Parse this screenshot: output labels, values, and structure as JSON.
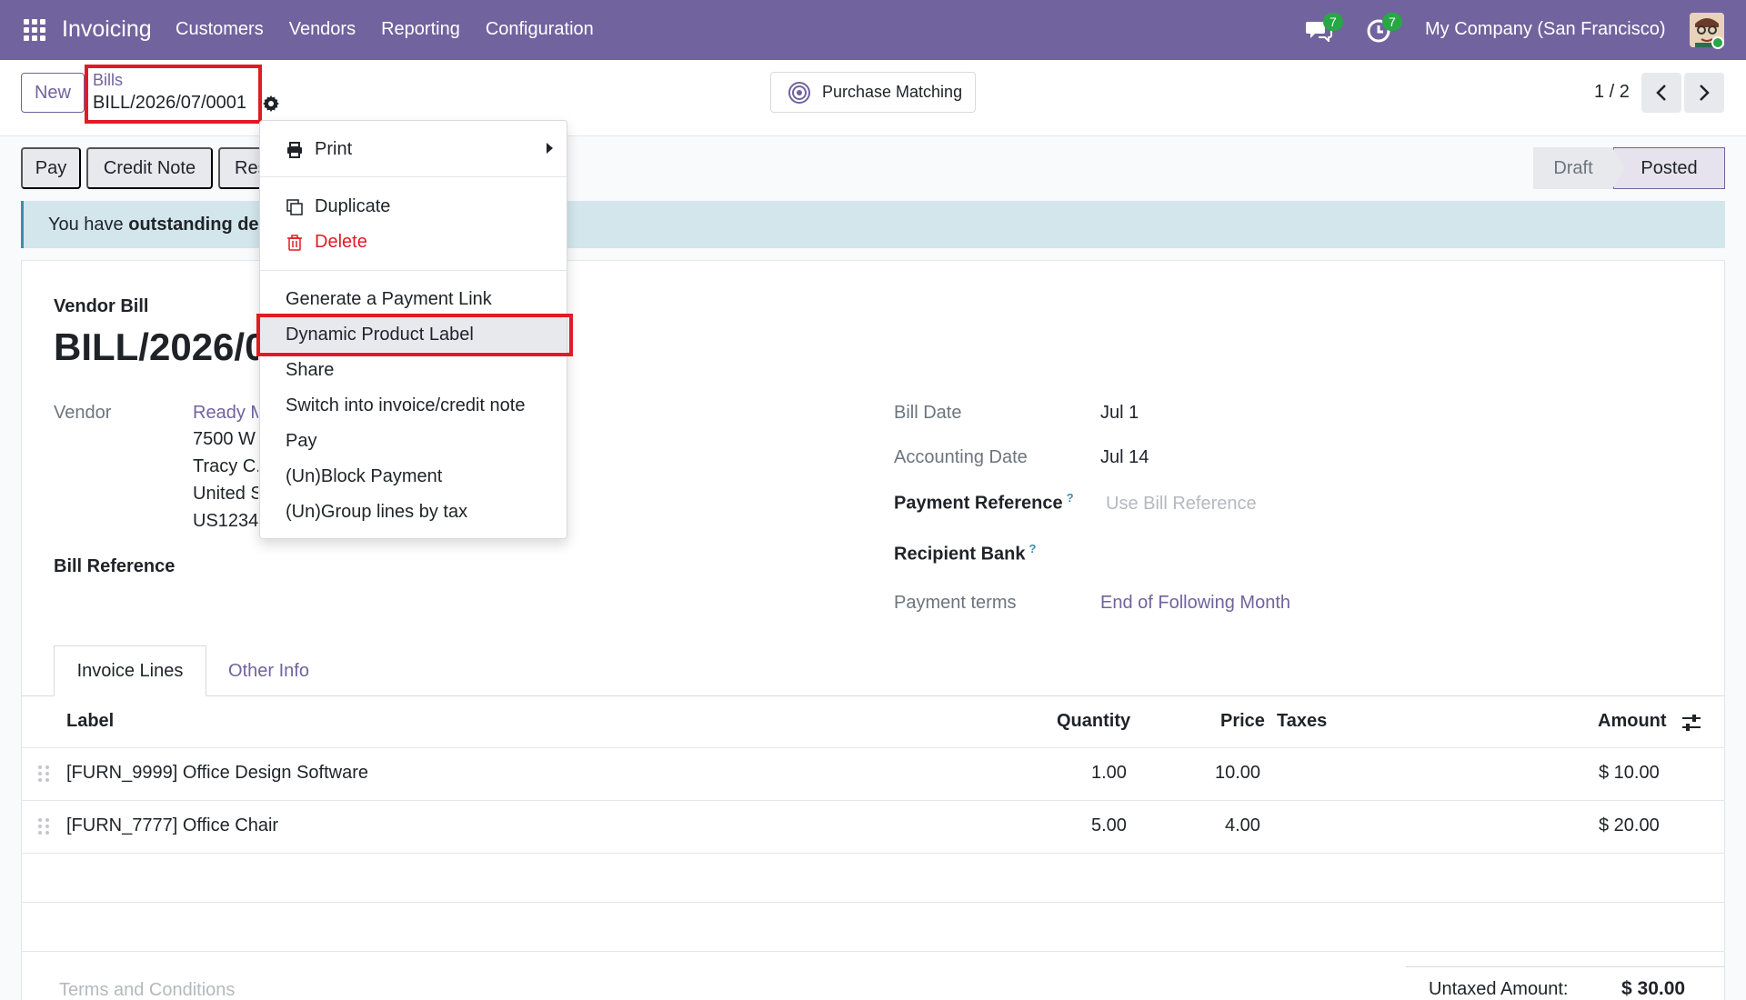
{
  "navbar": {
    "brand": "Invoicing",
    "menu": [
      "Customers",
      "Vendors",
      "Reporting",
      "Configuration"
    ],
    "messages_count": "7",
    "activities_count": "7",
    "company": "My Company (San Francisco)"
  },
  "control": {
    "new_label": "New",
    "breadcrumb_parent": "Bills",
    "breadcrumb_current": "BILL/2026/07/0001",
    "purchase_matching_label": "Purchase Matching",
    "pager": "1 / 2"
  },
  "actions": {
    "pay": "Pay",
    "credit_note": "Credit Note",
    "reset_partial": "Res"
  },
  "stages": {
    "draft": "Draft",
    "posted": "Posted",
    "current": "Posted"
  },
  "alert": {
    "prefix": "You have ",
    "bold": "outstanding del"
  },
  "form": {
    "doc_type": "Vendor Bill",
    "doc_name": "BILL/2026/07/0001",
    "vendor_label": "Vendor",
    "vendor_name": "Ready M",
    "vendor_address": [
      "7500 W",
      "Tracy C.",
      "United S",
      "US1234"
    ],
    "bill_reference_label": "Bill Reference",
    "bill_date_label": "Bill Date",
    "bill_date": "Jul 1",
    "accounting_date_label": "Accounting Date",
    "accounting_date": "Jul 14",
    "payment_reference_label": "Payment Reference",
    "payment_reference_placeholder": "Use Bill Reference",
    "recipient_bank_label": "Recipient Bank",
    "payment_terms_label": "Payment terms",
    "payment_terms": "End of Following Month",
    "help_mark": "?"
  },
  "tabs": [
    "Invoice Lines",
    "Other Info"
  ],
  "table": {
    "columns": [
      "Label",
      "Quantity",
      "Price",
      "Taxes",
      "Amount"
    ],
    "rows": [
      {
        "label": "[FURN_9999] Office Design Software",
        "quantity": "1.00",
        "price": "10.00",
        "taxes": "",
        "amount": "$ 10.00"
      },
      {
        "label": "[FURN_7777] Office Chair",
        "quantity": "5.00",
        "price": "4.00",
        "taxes": "",
        "amount": "$ 20.00"
      }
    ]
  },
  "footer": {
    "terms_placeholder": "Terms and Conditions",
    "untaxed_label": "Untaxed Amount:",
    "untaxed_value": "$ 30.00"
  },
  "dropdown": {
    "print": "Print",
    "duplicate": "Duplicate",
    "delete": "Delete",
    "items": [
      "Generate a Payment Link",
      "Dynamic Product Label",
      "Share",
      "Switch into invoice/credit note",
      "Pay",
      "(Un)Block Payment",
      "(Un)Group lines by tax"
    ],
    "highlighted": "Dynamic Product Label"
  },
  "colors": {
    "brand": "#71639e",
    "delete": "#e01b24",
    "annotation": "#e01b24",
    "badge": "#28a745",
    "alert_bg": "#d2e6ec"
  }
}
